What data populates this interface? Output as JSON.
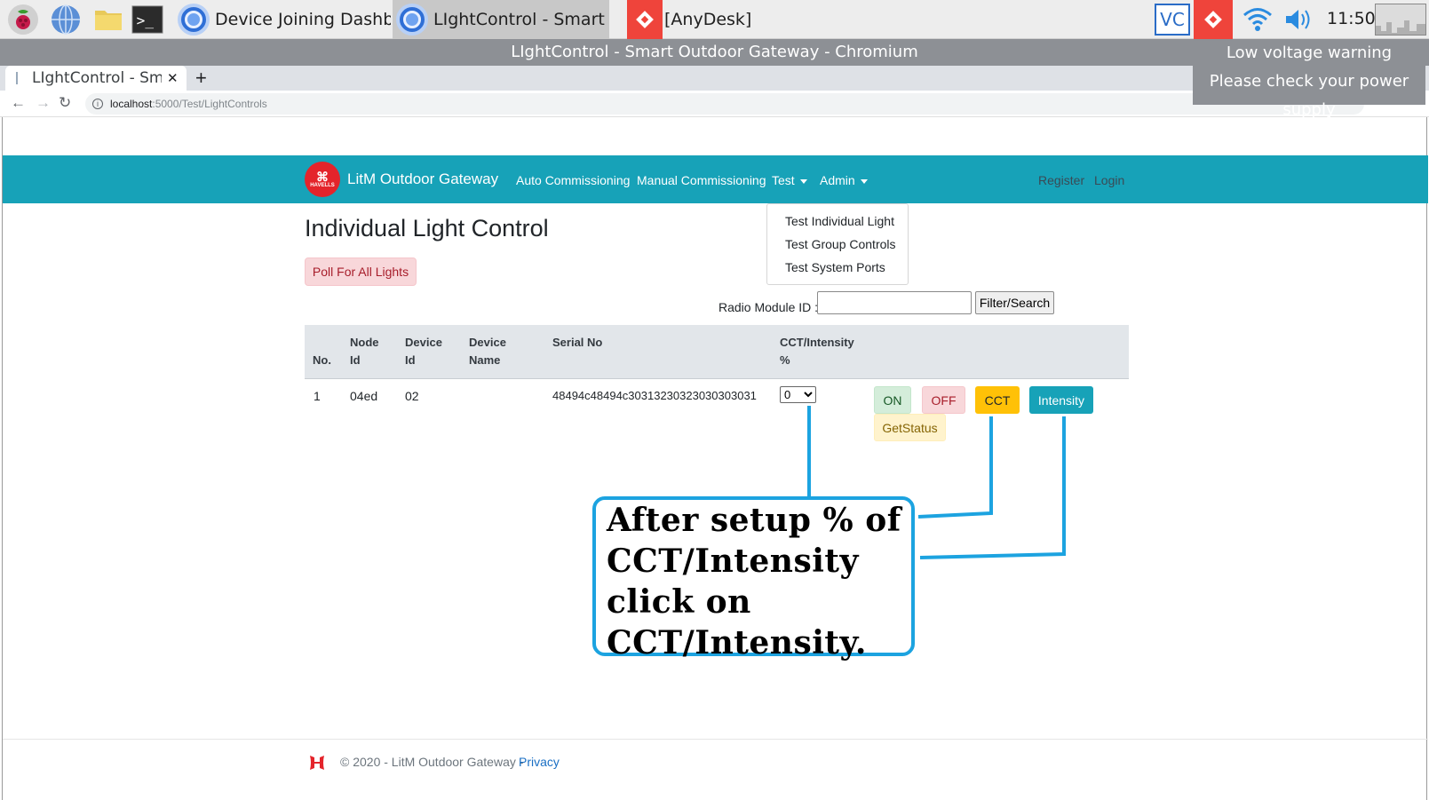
{
  "taskbar": {
    "tasks": [
      {
        "label": "Device Joining Dashboar..."
      },
      {
        "label": "LIghtControl - Smart Out..."
      },
      {
        "label": "[AnyDesk]"
      }
    ],
    "tray_badge": "VC",
    "clock": "11:50"
  },
  "window": {
    "title": "LIghtControl - Smart Outdoor Gateway - Chromium",
    "tab_title": "LIghtControl - Sma",
    "url_host": "localhost",
    "url_path": ":5000/Test/LightControls"
  },
  "notification": {
    "line1": "Low voltage warning",
    "line2": "Please check your power supply"
  },
  "navbar": {
    "brand": "LitM Outdoor Gateway",
    "logo_text": "HAVELLS",
    "links": [
      "Auto Commissioning",
      "Manual Commissioning",
      "Test",
      "Admin"
    ],
    "right_links": [
      "Register",
      "Login"
    ],
    "test_menu": [
      "Test Individual Light",
      "Test Group Controls",
      "Test System Ports"
    ]
  },
  "main": {
    "heading": "Individual Light Control",
    "poll_button": "Poll For All Lights",
    "radio_label": "Radio Module ID :",
    "radio_value": "",
    "filter_button": "Filter/Search",
    "table": {
      "headers": {
        "no": "No.",
        "node_id_1": "Node",
        "node_id_2": "Id",
        "device_id_1": "Device",
        "device_id_2": "Id",
        "device_name_1": "Device",
        "device_name_2": "Name",
        "serial": "Serial No",
        "cct_1": "CCT/Intensity",
        "cct_2": "%"
      },
      "rows": [
        {
          "no": "1",
          "node_id": "04ed",
          "device_id": "02",
          "device_name": "",
          "serial": "48494c48494c30313230323030303031",
          "cct_value": "0",
          "buttons": {
            "on": "ON",
            "off": "OFF",
            "cct": "CCT",
            "intensity": "Intensity",
            "status": "GetStatus"
          }
        }
      ]
    }
  },
  "callout": {
    "line1": "After setup % of",
    "line2": "CCT/Intensity",
    "line3": "click on",
    "line4": "CCT/Intensity."
  },
  "footer": {
    "text": "© 2020 - LitM Outdoor Gateway -",
    "link": "Privacy"
  },
  "colors": {
    "navbar": "#17a2b8",
    "callout_border": "#1ca3e0",
    "cct_button": "#ffc107",
    "intensity_button": "#17a2b8",
    "anydesk": "#ef443b"
  }
}
